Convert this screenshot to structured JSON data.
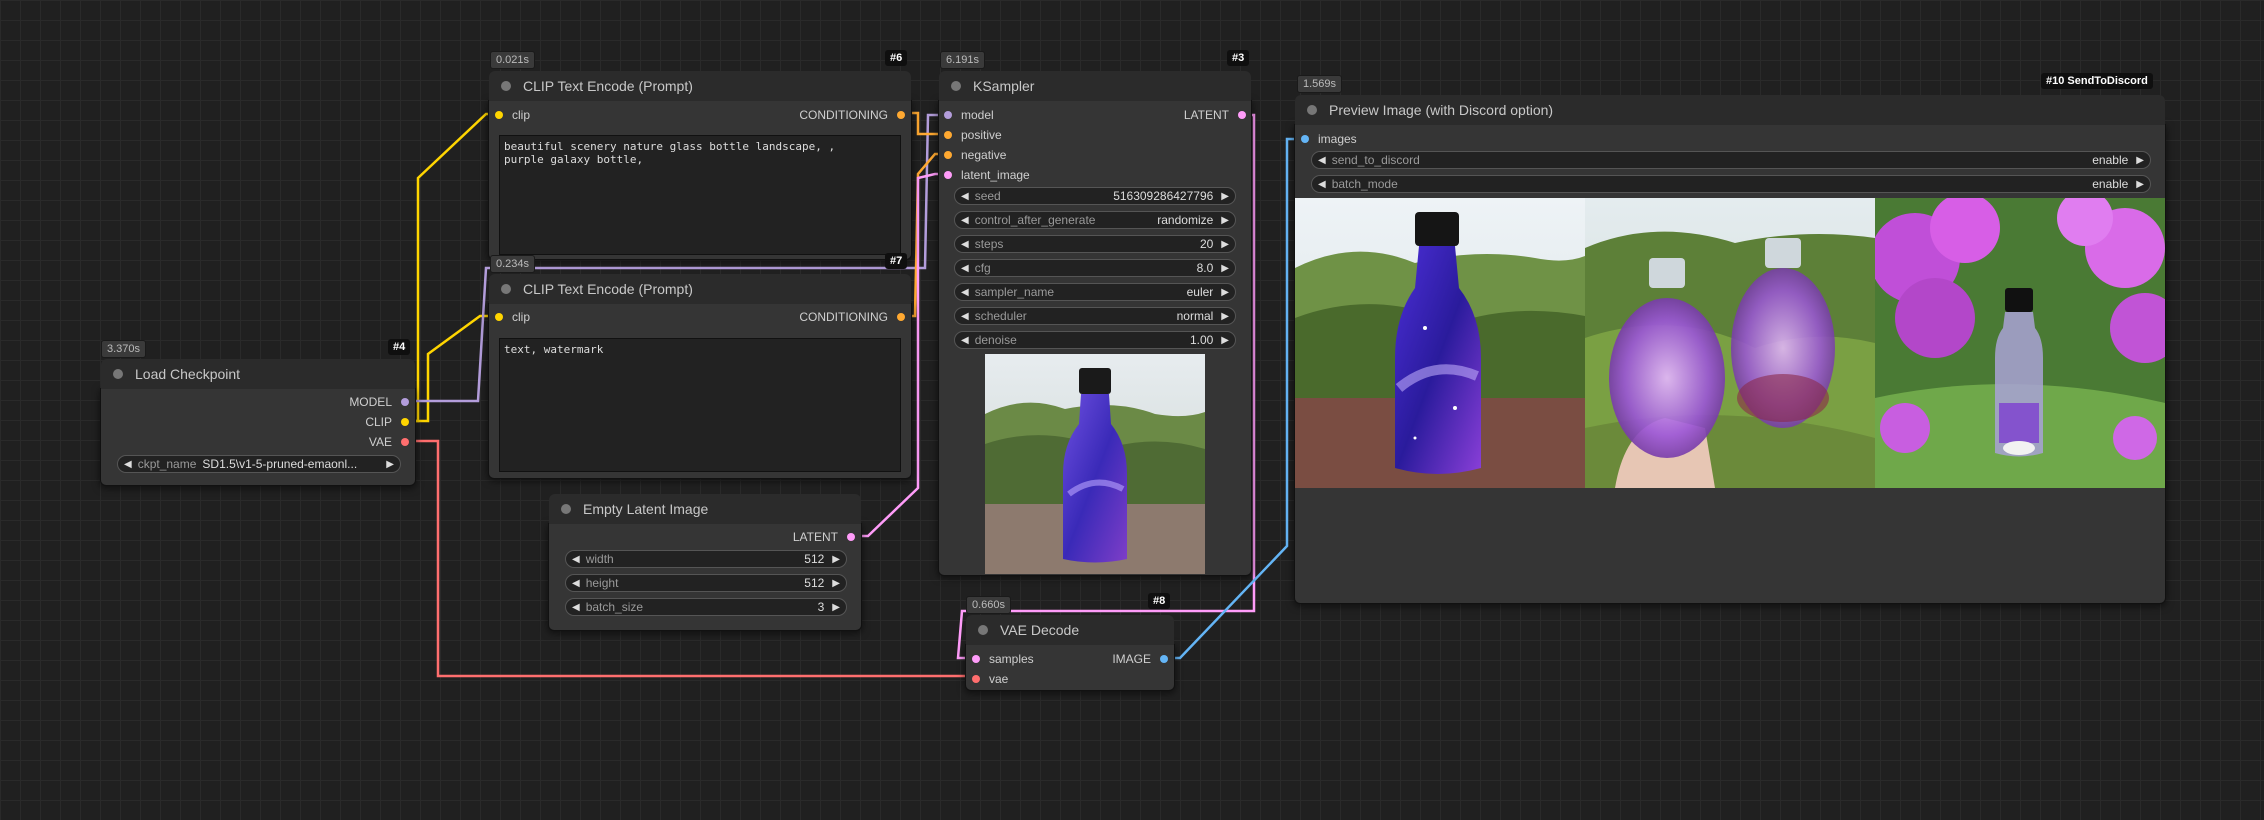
{
  "nodes": {
    "load_checkpoint": {
      "timing": "3.370s",
      "id": "#4",
      "title": "Load Checkpoint",
      "outputs": [
        "MODEL",
        "CLIP",
        "VAE"
      ],
      "widget": {
        "label": "ckpt_name",
        "value": "SD1.5\\v1-5-pruned-emaonl..."
      }
    },
    "clip_pos": {
      "timing": "0.021s",
      "id": "#6",
      "title": "CLIP Text Encode (Prompt)",
      "input": "clip",
      "output": "CONDITIONING",
      "text": "beautiful scenery nature glass bottle landscape, ,\npurple galaxy bottle,"
    },
    "clip_neg": {
      "timing": "0.234s",
      "id": "#7",
      "title": "CLIP Text Encode (Prompt)",
      "input": "clip",
      "output": "CONDITIONING",
      "text": "text, watermark"
    },
    "empty_latent": {
      "title": "Empty Latent Image",
      "output": "LATENT",
      "widgets": [
        {
          "label": "width",
          "value": "512"
        },
        {
          "label": "height",
          "value": "512"
        },
        {
          "label": "batch_size",
          "value": "3"
        }
      ]
    },
    "ksampler": {
      "timing": "6.191s",
      "id": "#3",
      "title": "KSampler",
      "inputs": [
        "model",
        "positive",
        "negative",
        "latent_image"
      ],
      "output": "LATENT",
      "widgets": [
        {
          "label": "seed",
          "value": "516309286427796"
        },
        {
          "label": "control_after_generate",
          "value": "randomize"
        },
        {
          "label": "steps",
          "value": "20"
        },
        {
          "label": "cfg",
          "value": "8.0"
        },
        {
          "label": "sampler_name",
          "value": "euler"
        },
        {
          "label": "scheduler",
          "value": "normal"
        },
        {
          "label": "denoise",
          "value": "1.00"
        }
      ]
    },
    "vae_decode": {
      "timing": "0.660s",
      "id": "#8",
      "title": "VAE Decode",
      "inputs": [
        "samples",
        "vae"
      ],
      "output": "IMAGE"
    },
    "preview": {
      "timing": "1.569s",
      "id": "#10 SendToDiscord",
      "title": "Preview Image (with Discord option)",
      "input": "images",
      "widgets": [
        {
          "label": "send_to_discord",
          "value": "enable"
        },
        {
          "label": "batch_mode",
          "value": "enable"
        }
      ]
    }
  },
  "colors": {
    "clip": "#ffd500",
    "conditioning": "#ffa931",
    "model": "#b39ddb",
    "latent": "#ff9cf9",
    "vae": "#ff6e6e",
    "image": "#64b5f6"
  }
}
